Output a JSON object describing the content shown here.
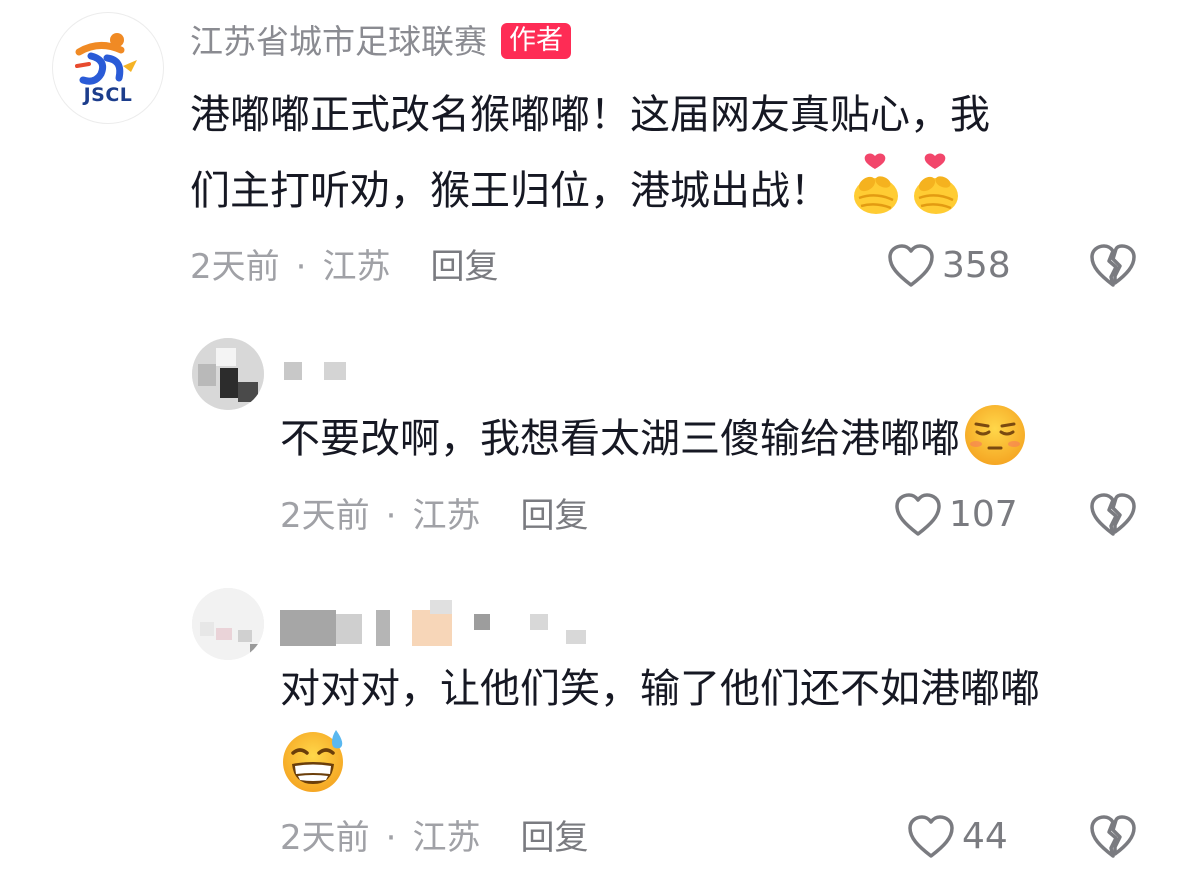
{
  "comments": [
    {
      "author": "江苏省城市足球联赛",
      "badge": "作者",
      "avatar_text": "JSCL",
      "lines": [
        "港嘟嘟正式改名猴嘟嘟！这届网友真贴心，我",
        "们主打听劝，猴王归位，港城出战！"
      ],
      "emojis": [
        "heart-hands-emoji",
        "heart-hands-emoji"
      ],
      "time": "2天前",
      "location": "江苏",
      "reply": "回复",
      "likes": "358"
    },
    {
      "author": "",
      "lines": [
        "不要改啊，我想看太湖三傻输给港嘟嘟"
      ],
      "emojis": [
        "unamused-face-emoji"
      ],
      "time": "2天前",
      "location": "江苏",
      "reply": "回复",
      "likes": "107"
    },
    {
      "author": "",
      "lines": [
        "对对对，让他们笑，输了他们还不如港嘟嘟"
      ],
      "emojis": [
        "grinning-sweat-emoji"
      ],
      "time": "2天前",
      "location": "江苏",
      "reply": "回复",
      "likes": "44"
    }
  ],
  "separator": "·",
  "colors": {
    "badge": "#fe2c55",
    "name": "#8a8b91",
    "meta": "#a0a1a6",
    "text": "#161823"
  }
}
